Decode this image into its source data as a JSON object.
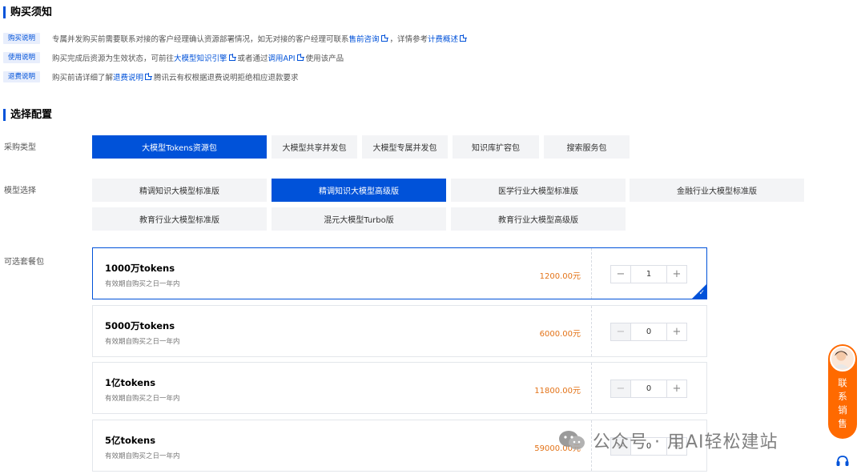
{
  "notice": {
    "title": "购买须知",
    "rows": [
      {
        "tag": "购买说明",
        "pre": "专属并发购买前需要联系对接的客户经理确认资源部署情况，如无对接的客户经理可联系",
        "link1": "售前咨询",
        "mid": "，详情参考",
        "link2": "计费概述",
        "post": ""
      },
      {
        "tag": "使用说明",
        "pre": "购买完成后资源为生效状态，可前往",
        "link1": "大模型知识引擎",
        "mid": "或者通过",
        "link2": "调用API",
        "post": "使用该产品"
      },
      {
        "tag": "退费说明",
        "pre": "购买前请详细了解",
        "link1": "退费说明",
        "mid": "腾讯云有权根据退费说明拒绝相应退款要求",
        "link2": "",
        "post": ""
      }
    ]
  },
  "config": {
    "title": "选择配置",
    "purchase_type_label": "采购类型",
    "purchase_types": [
      "大模型Tokens资源包",
      "大模型共享并发包",
      "大模型专属并发包",
      "知识库扩容包",
      "搜索服务包"
    ],
    "purchase_type_selected": "大模型Tokens资源包",
    "model_label": "模型选择",
    "models": [
      "精调知识大模型标准版",
      "精调知识大模型高级版",
      "医学行业大模型标准版",
      "金融行业大模型标准版",
      "教育行业大模型标准版",
      "混元大模型Turbo版",
      "教育行业大模型高级版"
    ],
    "model_selected": "精调知识大模型高级版",
    "package_label": "可选套餐包",
    "packages": [
      {
        "name": "1000万tokens",
        "desc": "有效期自购买之日一年内",
        "price": "1200.00元",
        "qty": "1",
        "selected": true
      },
      {
        "name": "5000万tokens",
        "desc": "有效期自购买之日一年内",
        "price": "6000.00元",
        "qty": "0",
        "selected": false
      },
      {
        "name": "1亿tokens",
        "desc": "有效期自购买之日一年内",
        "price": "11800.00元",
        "qty": "0",
        "selected": false
      },
      {
        "name": "5亿tokens",
        "desc": "有效期自购买之日一年内",
        "price": "59000.00元",
        "qty": "0",
        "selected": false
      }
    ],
    "stepper_minus": "−",
    "stepper_plus": "+"
  },
  "sales_widget": {
    "label": "联系销售"
  },
  "watermark": {
    "text": "公众号 · 用AI轻松建站"
  },
  "colors": {
    "accent": "#0052d9",
    "price": "#e37318",
    "sales": "#ff6a00"
  }
}
